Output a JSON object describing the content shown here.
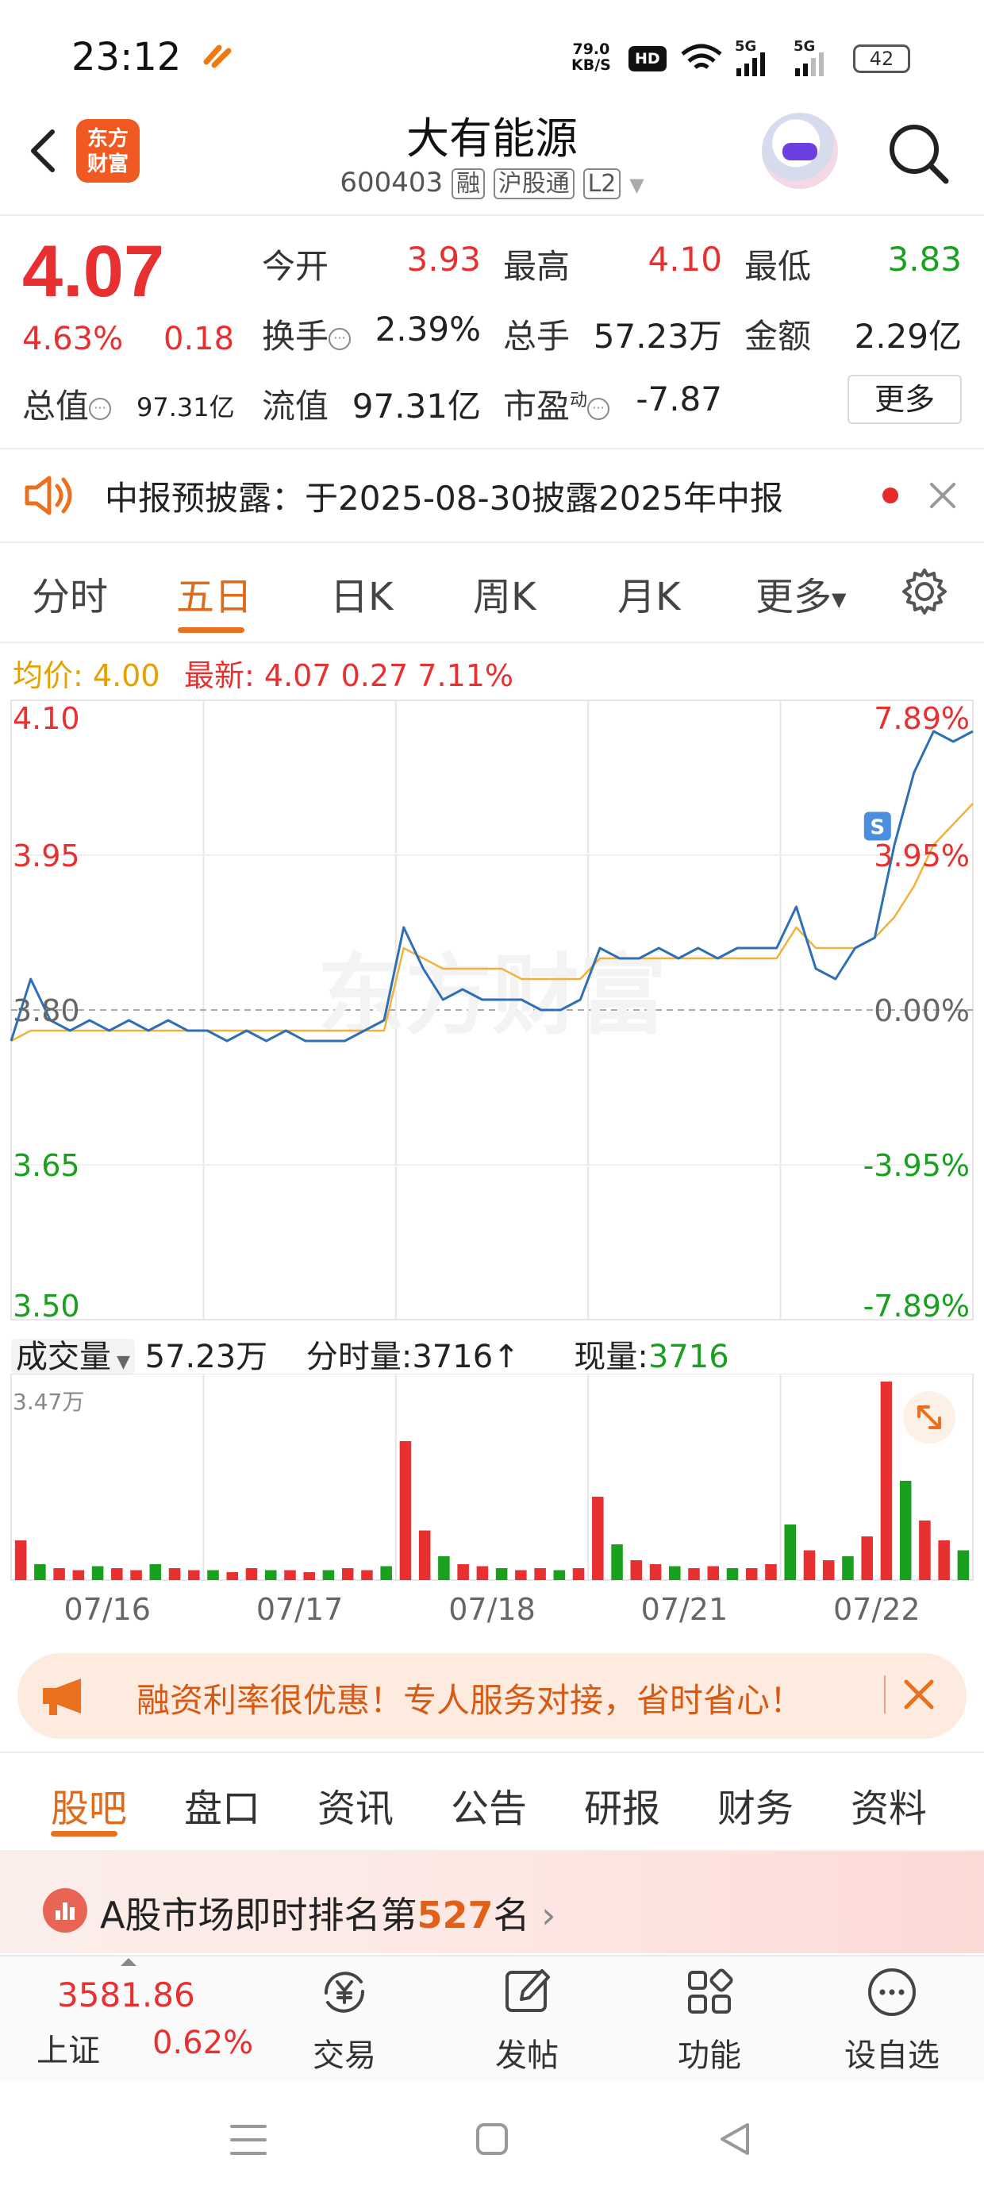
{
  "status_bar": {
    "time": "23:12",
    "net_speed": "79.0",
    "net_unit": "KB/S",
    "hd": "HD",
    "signal1": "5G",
    "signal2": "5G",
    "battery": "42"
  },
  "header": {
    "logo_line1": "东方",
    "logo_line2": "财富",
    "title": "大有能源",
    "code": "600403",
    "tag_rong": "融",
    "tag_hgt": "沪股通",
    "tag_l2": "L2"
  },
  "quote": {
    "price": "4.07",
    "change_pct": "4.63%",
    "change": "0.18",
    "open_label": "今开",
    "open": "3.93",
    "high_label": "最高",
    "high": "4.10",
    "low_label": "最低",
    "low": "3.83",
    "turnover_label": "换手",
    "turnover": "2.39%",
    "volume_label": "总手",
    "volume": "57.23万",
    "amount_label": "金额",
    "amount": "2.29亿",
    "mktcap_label": "总值",
    "mktcap": "97.31亿",
    "float_label": "流值",
    "float": "97.31亿",
    "pe_label": "市盈",
    "pe_sup": "动",
    "pe": "-7.87",
    "more": "更多"
  },
  "notice": {
    "text": "中报预披露：于2025-08-30披露2025年中报"
  },
  "tabs": [
    "分时",
    "五日",
    "日K",
    "周K",
    "月K",
    "更多"
  ],
  "chart_header": {
    "avg_label": "均价:",
    "avg": "4.00",
    "latest_label": "最新:",
    "latest": "4.07",
    "latest_chg": "0.27",
    "latest_pct": "7.11%"
  },
  "chart_data": {
    "type": "line",
    "y_left_ticks": [
      "4.10",
      "3.95",
      "3.80",
      "3.65",
      "3.50"
    ],
    "y_right_ticks": [
      "7.89%",
      "3.95%",
      "0.00%",
      "-3.95%",
      "-7.89%"
    ],
    "ylim": [
      3.5,
      4.1
    ],
    "reference": 3.8,
    "x_labels": [
      "07/16",
      "07/17",
      "07/18",
      "07/21",
      "07/22"
    ],
    "series": [
      {
        "values": [
          3.77,
          3.83,
          3.79,
          3.78,
          3.79,
          3.78,
          3.79,
          3.78,
          3.79,
          3.78,
          3.78,
          3.77,
          3.78,
          3.77,
          3.78,
          3.77,
          3.77,
          3.77,
          3.78,
          3.79,
          3.88,
          3.84,
          3.81,
          3.82,
          3.81,
          3.81,
          3.81,
          3.8,
          3.8,
          3.81,
          3.86,
          3.85,
          3.85,
          3.86,
          3.85,
          3.86,
          3.85,
          3.86,
          3.86,
          3.86,
          3.9,
          3.84,
          3.83,
          3.86,
          3.87,
          3.96,
          4.03,
          4.07,
          4.06,
          4.07
        ]
      },
      {
        "values": [
          3.77,
          3.78,
          3.78,
          3.78,
          3.78,
          3.78,
          3.78,
          3.78,
          3.78,
          3.78,
          3.78,
          3.78,
          3.78,
          3.78,
          3.78,
          3.78,
          3.78,
          3.78,
          3.78,
          3.78,
          3.86,
          3.85,
          3.84,
          3.84,
          3.84,
          3.84,
          3.83,
          3.83,
          3.83,
          3.83,
          3.85,
          3.85,
          3.85,
          3.85,
          3.85,
          3.85,
          3.85,
          3.85,
          3.85,
          3.85,
          3.88,
          3.86,
          3.86,
          3.86,
          3.87,
          3.89,
          3.92,
          3.96,
          3.98,
          4.0
        ]
      }
    ],
    "colors": {
      "price": "#2e6fb5",
      "avg": "#f0b23c",
      "up": "#e83030",
      "down": "#18a01e"
    }
  },
  "volume": {
    "selector": "成交量",
    "total": "57.23万",
    "tick_label": "分时量:",
    "tick": "3716",
    "now_label": "现量:",
    "now": "3716",
    "max_label": "3.47万",
    "bars": [
      0.2,
      0.08,
      0.06,
      0.05,
      0.07,
      0.06,
      0.05,
      0.08,
      0.06,
      0.05,
      0.05,
      0.04,
      0.06,
      0.05,
      0.05,
      0.04,
      0.05,
      0.06,
      0.05,
      0.07,
      0.7,
      0.25,
      0.12,
      0.08,
      0.07,
      0.06,
      0.05,
      0.06,
      0.05,
      0.06,
      0.42,
      0.18,
      0.1,
      0.08,
      0.07,
      0.06,
      0.07,
      0.06,
      0.06,
      0.08,
      0.28,
      0.15,
      0.1,
      0.12,
      0.22,
      1.0,
      0.5,
      0.3,
      0.2,
      0.15
    ]
  },
  "promo": {
    "text": "融资利率很优惠！专人服务对接，省时省心！"
  },
  "bottom_tabs": [
    "股吧",
    "盘口",
    "资讯",
    "公告",
    "研报",
    "财务",
    "资料"
  ],
  "rank": {
    "prefix": "A股市场即时排名第",
    "num": "527",
    "suffix": "名"
  },
  "index": {
    "value": "3581.86",
    "name": "上证",
    "pct": "0.62%"
  },
  "nav": [
    {
      "label": "交易"
    },
    {
      "label": "发帖"
    },
    {
      "label": "功能"
    },
    {
      "label": "设自选"
    }
  ]
}
